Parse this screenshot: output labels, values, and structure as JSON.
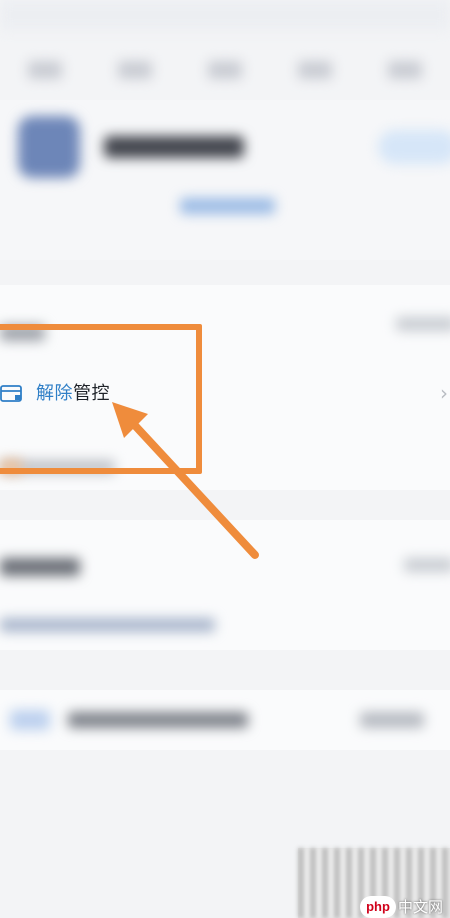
{
  "row": {
    "label_part1": "解除",
    "label_part2": "管控",
    "chevron": "›",
    "icon": "card-icon"
  },
  "annotation": {
    "highlight_color": "#ef8c3c",
    "arrow_color": "#ef8c3c"
  },
  "watermark": {
    "badge": "php",
    "text": "中文网"
  },
  "colors": {
    "accent_blue": "#2f7fc7",
    "text_dark": "#1f2329"
  }
}
